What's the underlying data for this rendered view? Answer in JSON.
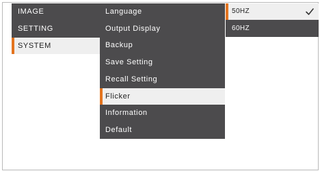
{
  "menu": {
    "categories": [
      {
        "label": "IMAGE",
        "selected": false
      },
      {
        "label": "SETTING",
        "selected": false
      },
      {
        "label": "SYSTEM",
        "selected": true
      }
    ],
    "system_items": [
      {
        "label": "Language",
        "selected": false
      },
      {
        "label": "Output Display",
        "selected": false
      },
      {
        "label": "Backup",
        "selected": false
      },
      {
        "label": "Save Setting",
        "selected": false
      },
      {
        "label": "Recall Setting",
        "selected": false
      },
      {
        "label": "Flicker",
        "selected": true
      },
      {
        "label": "Information",
        "selected": false
      },
      {
        "label": "Default",
        "selected": false
      }
    ],
    "flicker_options": [
      {
        "label": "50HZ",
        "selected": true,
        "checked": true
      },
      {
        "label": "60HZ",
        "selected": false,
        "checked": false
      }
    ]
  },
  "colors": {
    "panel": "#4c4b4d",
    "highlight": "#efefef",
    "accent": "#e3741f"
  },
  "icons": {
    "checked_indicator": "check-icon"
  }
}
